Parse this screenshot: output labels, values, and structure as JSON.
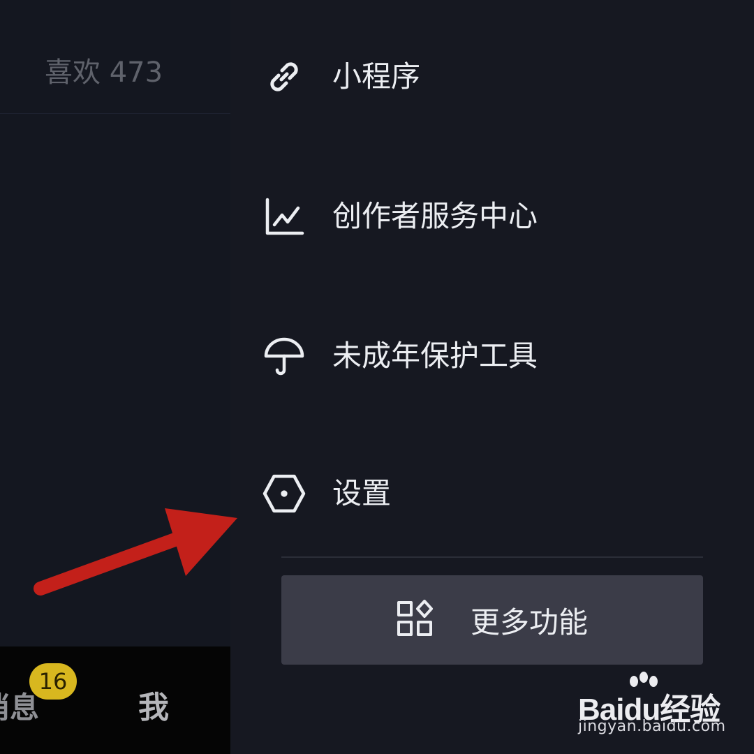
{
  "left_panel": {
    "likes_label": "喜欢 473"
  },
  "bottom_nav": {
    "messages_label": "消息",
    "messages_badge": "16",
    "me_label": "我"
  },
  "drawer": {
    "items": [
      {
        "label": "小程序",
        "icon": "link-icon"
      },
      {
        "label": "创作者服务中心",
        "icon": "line-chart-icon"
      },
      {
        "label": "未成年保护工具",
        "icon": "umbrella-icon"
      },
      {
        "label": "设置",
        "icon": "settings-hexagon-icon"
      }
    ],
    "more_button": {
      "label": "更多功能",
      "icon": "grid-apps-icon"
    }
  },
  "annotation": {
    "arrow_color": "#c3201a"
  },
  "watermark": {
    "logo_text": "Baidu经验",
    "url": "jingyan.baidu.com"
  },
  "colors": {
    "background": "#161821",
    "text": "#eceef2",
    "badge": "#d8b71f",
    "button_bg": "#3b3c48"
  }
}
